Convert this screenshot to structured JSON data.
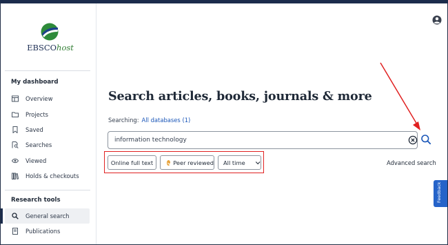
{
  "brand": {
    "logo_prefix": "EBSCO",
    "logo_suffix": "host"
  },
  "sidebar": {
    "dashboard_heading": "My dashboard",
    "dashboard_items": [
      {
        "label": "Overview",
        "icon": "overview-icon"
      },
      {
        "label": "Projects",
        "icon": "projects-icon"
      },
      {
        "label": "Saved",
        "icon": "bookmark-icon"
      },
      {
        "label": "Searches",
        "icon": "searches-icon"
      },
      {
        "label": "Viewed",
        "icon": "eye-icon"
      },
      {
        "label": "Holds & checkouts",
        "icon": "books-icon"
      }
    ],
    "research_heading": "Research tools",
    "research_items": [
      {
        "label": "General search",
        "icon": "search-icon",
        "active": true
      },
      {
        "label": "Publications",
        "icon": "publications-icon"
      }
    ]
  },
  "main": {
    "title": "Search articles, books, journals & more",
    "searching_label": "Searching:",
    "searching_databases": "All databases (1)",
    "search_value": "information technology",
    "filters": {
      "online_full_text": "Online full text",
      "peer_reviewed": "Peer reviewed",
      "date_range": "All time"
    },
    "advanced_search": "Advanced search",
    "feedback": "Feedback"
  },
  "colors": {
    "topbar": "#1b2c4c",
    "link": "#1a56b8",
    "annotation": "#e02020",
    "feedback": "#2563c9"
  }
}
